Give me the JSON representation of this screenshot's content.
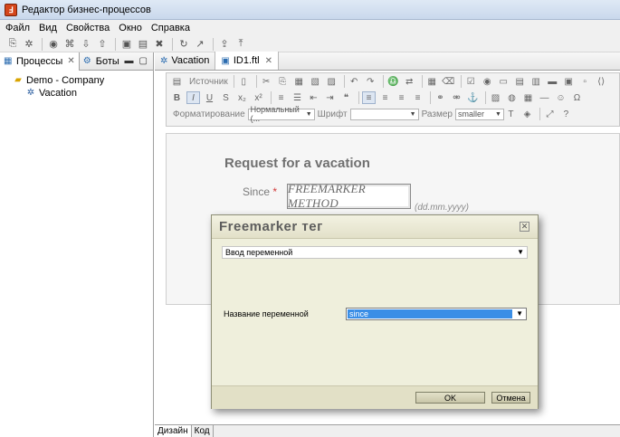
{
  "window": {
    "title": "Редактор бизнес-процессов",
    "logo": "app-logo-icon"
  },
  "menu": [
    "Файл",
    "Вид",
    "Свойства",
    "Окно",
    "Справка"
  ],
  "left_panel": {
    "tabs": [
      {
        "label": "Процессы",
        "close": "✕"
      },
      {
        "label": "Боты"
      }
    ],
    "tree": [
      {
        "label": "Demo - Company",
        "icon": "folder-icon"
      },
      {
        "label": "Vacation",
        "icon": "process-icon"
      }
    ]
  },
  "editor": {
    "tabs": [
      {
        "label": "Vacation"
      },
      {
        "label": "ID1.ftl",
        "close": "✕"
      }
    ],
    "rte": {
      "source_label": "Источник",
      "format_label": "Форматирование",
      "format_value": "Нормальный (...",
      "font_label": "Шрифт",
      "size_label": "Размер",
      "size_value": "smaller"
    },
    "doc": {
      "title": "Request for a vacation",
      "since_label": "Since",
      "required_mark": "*",
      "freemarker_placeholder": "FREEMARKER METHOD",
      "date_hint": "(dd.mm.yyyy)"
    },
    "bottom_tabs": [
      "Дизайн",
      "Код"
    ]
  },
  "dialog": {
    "title": "Freemarker тег",
    "close": "✕",
    "tag_type": "Ввод переменной",
    "var_label": "Название переменной",
    "var_value": "since",
    "ok": "OK",
    "cancel": "Отмена"
  }
}
